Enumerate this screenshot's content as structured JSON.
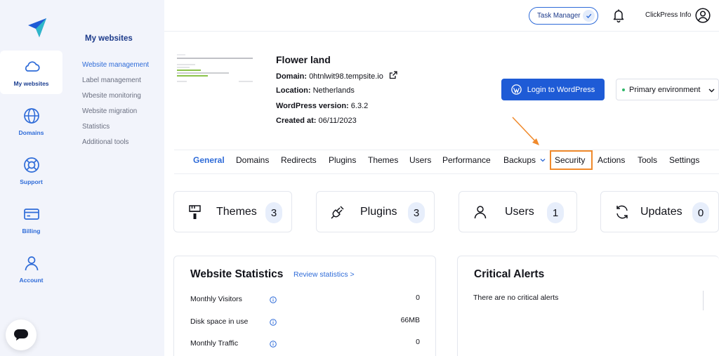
{
  "sidebar": {
    "items": [
      {
        "label": "My websites",
        "icon": "cloud-icon"
      },
      {
        "label": "Domains",
        "icon": "globe-icon"
      },
      {
        "label": "Support",
        "icon": "lifebuoy-icon"
      },
      {
        "label": "Billing",
        "icon": "credit-card-icon"
      },
      {
        "label": "Account",
        "icon": "user-icon"
      }
    ]
  },
  "submenu": {
    "title": "My websites",
    "items": [
      {
        "label": "Website management"
      },
      {
        "label": "Label management"
      },
      {
        "label": "Wbesite monitoring"
      },
      {
        "label": "Website migration"
      },
      {
        "label": "Statistics"
      },
      {
        "label": "Additional tools"
      }
    ]
  },
  "topbar": {
    "task_manager": "Task Manager",
    "user_name": "ClickPress Info"
  },
  "site": {
    "name": "Flower land",
    "domain_label": "Domain:",
    "domain_value": "0htnlwit98.tempsite.io",
    "location_label": "Location:",
    "location_value": "Netherlands",
    "wp_version_label": "WordPress version:",
    "wp_version_value": "6.3.2",
    "created_label": "Created at:",
    "created_value": "06/11/2023",
    "login_button": "Login to WordPress",
    "environment": "Primary environment"
  },
  "tabs": [
    {
      "label": "General"
    },
    {
      "label": "Domains"
    },
    {
      "label": "Redirects"
    },
    {
      "label": "Plugins"
    },
    {
      "label": "Themes"
    },
    {
      "label": "Users"
    },
    {
      "label": "Performance"
    },
    {
      "label": "Backups"
    },
    {
      "label": "Security"
    },
    {
      "label": "Actions"
    },
    {
      "label": "Tools"
    },
    {
      "label": "Settings"
    }
  ],
  "active_tab": "General",
  "highlighted_tab": "Security",
  "stats": [
    {
      "label": "Themes",
      "count": "3",
      "icon": "paint-roller-icon"
    },
    {
      "label": "Plugins",
      "count": "3",
      "icon": "plug-icon"
    },
    {
      "label": "Users",
      "count": "1",
      "icon": "user-icon"
    },
    {
      "label": "Updates",
      "count": "0",
      "icon": "refresh-icon"
    }
  ],
  "website_statistics": {
    "title": "Website Statistics",
    "review_link": "Review statistics >",
    "rows": [
      {
        "label": "Monthly Visitors",
        "value": "0"
      },
      {
        "label": "Disk space in use",
        "value": "66MB"
      },
      {
        "label": "Monthly Traffic",
        "value": "0"
      }
    ]
  },
  "critical_alerts": {
    "title": "Critical Alerts",
    "message": "There are no critical alerts"
  },
  "colors": {
    "primary": "#1e5bd6",
    "link": "#2e6bd8",
    "highlight": "#f08a2c",
    "sidebar_bg": "#f2f4fb",
    "status_green": "#2fb768"
  }
}
